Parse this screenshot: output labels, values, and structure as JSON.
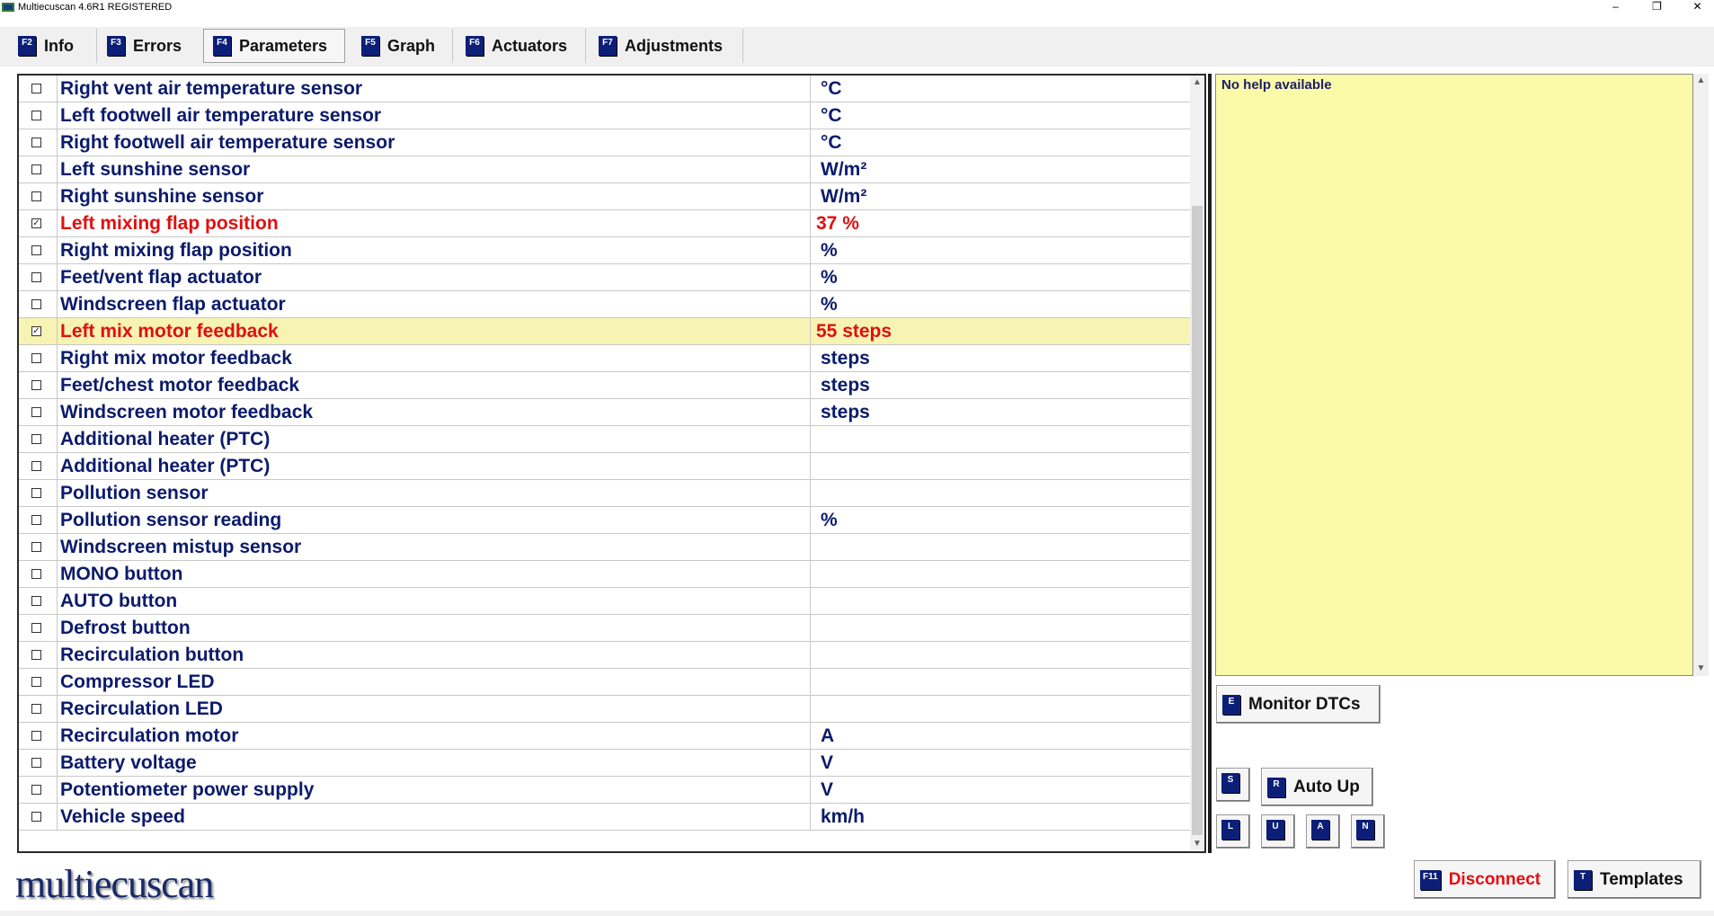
{
  "window": {
    "title": "Multiecuscan 4.6R1 REGISTERED",
    "minimize": "–",
    "restore": "❐",
    "close": "✕"
  },
  "tabs": [
    {
      "key": "F2",
      "label": "Info",
      "active": false
    },
    {
      "key": "F3",
      "label": "Errors",
      "active": false
    },
    {
      "key": "F4",
      "label": "Parameters",
      "active": true
    },
    {
      "key": "F5",
      "label": "Graph",
      "active": false
    },
    {
      "key": "F6",
      "label": "Actuators",
      "active": false
    },
    {
      "key": "F7",
      "label": "Adjustments",
      "active": false
    }
  ],
  "parameters": [
    {
      "name": "Right vent air temperature sensor",
      "value": "°C",
      "checked": false
    },
    {
      "name": "Left footwell air temperature sensor",
      "value": "°C",
      "checked": false
    },
    {
      "name": "Right footwell air temperature sensor",
      "value": "°C",
      "checked": false
    },
    {
      "name": "Left sunshine sensor",
      "value": "W/m²",
      "checked": false
    },
    {
      "name": "Right sunshine sensor",
      "value": "W/m²",
      "checked": false
    },
    {
      "name": "Left mixing flap position",
      "value": "37 %",
      "checked": true
    },
    {
      "name": "Right mixing flap position",
      "value": "%",
      "checked": false
    },
    {
      "name": "Feet/vent flap actuator",
      "value": "%",
      "checked": false
    },
    {
      "name": "Windscreen flap actuator",
      "value": "%",
      "checked": false
    },
    {
      "name": "Left mix motor feedback",
      "value": "55 steps",
      "checked": true,
      "highlighted": true
    },
    {
      "name": "Right mix motor feedback",
      "value": "steps",
      "checked": false
    },
    {
      "name": "Feet/chest motor feedback",
      "value": "steps",
      "checked": false
    },
    {
      "name": "Windscreen motor feedback",
      "value": "steps",
      "checked": false
    },
    {
      "name": "Additional heater (PTC)",
      "value": "",
      "checked": false
    },
    {
      "name": "Additional heater (PTC)",
      "value": "",
      "checked": false
    },
    {
      "name": "Pollution sensor",
      "value": "",
      "checked": false
    },
    {
      "name": "Pollution sensor reading",
      "value": "%",
      "checked": false
    },
    {
      "name": "Windscreen mistup sensor",
      "value": "",
      "checked": false
    },
    {
      "name": "MONO button",
      "value": "",
      "checked": false
    },
    {
      "name": "AUTO button",
      "value": "",
      "checked": false
    },
    {
      "name": "Defrost button",
      "value": "",
      "checked": false
    },
    {
      "name": "Recirculation button",
      "value": "",
      "checked": false
    },
    {
      "name": "Compressor LED",
      "value": "",
      "checked": false
    },
    {
      "name": "Recirculation LED",
      "value": "",
      "checked": false
    },
    {
      "name": "Recirculation motor",
      "value": "A",
      "checked": false
    },
    {
      "name": "Battery voltage",
      "value": "V",
      "checked": false
    },
    {
      "name": "Potentiometer power supply",
      "value": "V",
      "checked": false
    },
    {
      "name": "Vehicle speed",
      "value": "km/h",
      "checked": false
    }
  ],
  "help": {
    "text": "No help available"
  },
  "buttons": {
    "monitor_dtcs": {
      "key": "E",
      "label": "Monitor DTCs"
    },
    "s": {
      "key": "S"
    },
    "auto_up": {
      "key": "R",
      "label": "Auto Up"
    },
    "l": {
      "key": "L"
    },
    "u": {
      "key": "U"
    },
    "a": {
      "key": "A"
    },
    "n": {
      "key": "N"
    },
    "disconnect": {
      "key": "F11",
      "label": "Disconnect"
    },
    "templates": {
      "key": "T",
      "label": "Templates"
    }
  },
  "logo": {
    "text": "multiecuscan"
  },
  "colors": {
    "key_badge": "#0c1f78",
    "param_text": "#0b1b6b",
    "selected_text": "#e01010",
    "highlight_row": "#f7f3b3",
    "help_bg": "#fafaa8",
    "disconnect_text": "#e01010"
  }
}
